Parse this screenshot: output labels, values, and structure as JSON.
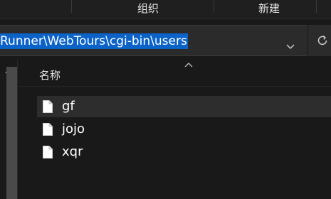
{
  "ribbon": {
    "organize_label": "组织",
    "new_label": "新建"
  },
  "address_bar": {
    "path": "Runner\\WebTours\\cgi-bin\\users",
    "dropdown_icon": "chevron-down-icon",
    "refresh_icon": "refresh-icon"
  },
  "file_list": {
    "column_name_header": "名称",
    "sort_indicator_icon": "sort-up-icon",
    "items": [
      {
        "name": "gf",
        "icon": "file-icon",
        "selected": true
      },
      {
        "name": "jojo",
        "icon": "file-icon",
        "selected": false
      },
      {
        "name": "xqr",
        "icon": "file-icon",
        "selected": false
      }
    ]
  },
  "colors": {
    "background": "#191919",
    "address_bg": "#2b2b2b",
    "selection_highlight": "#0b63c9",
    "selected_row": "#2d2d2d",
    "scrollbar_thumb": "#4a4a4a"
  }
}
